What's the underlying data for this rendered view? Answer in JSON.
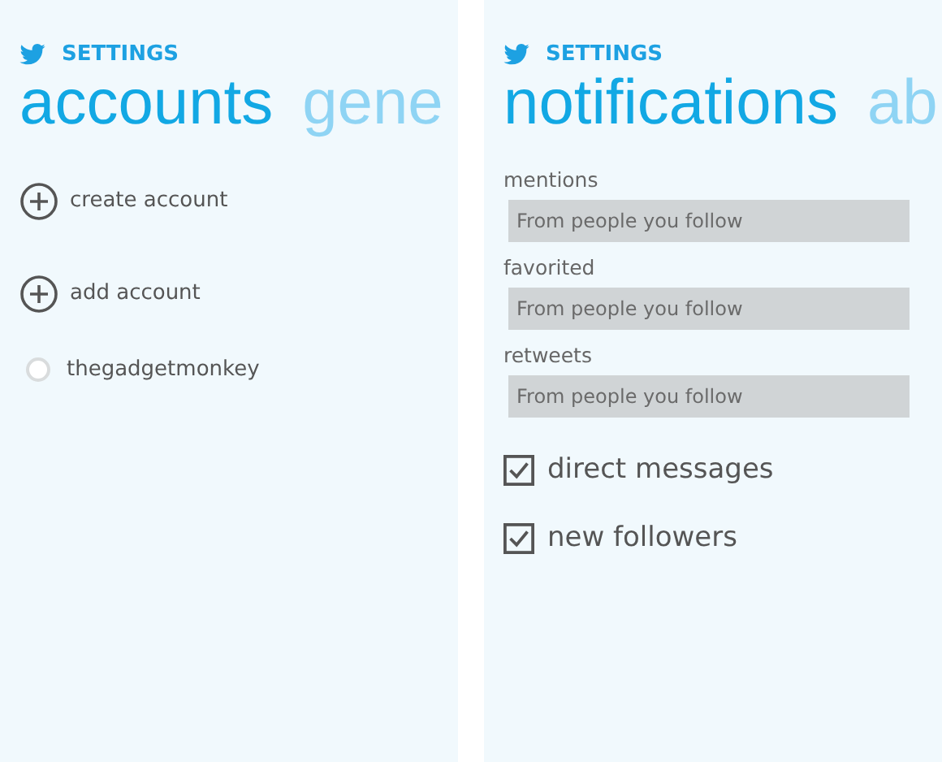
{
  "panels": [
    {
      "app_label": "SETTINGS",
      "pivots": [
        {
          "label": "accounts",
          "selected": true
        },
        {
          "label": "gene",
          "selected": false
        }
      ],
      "items": [
        {
          "kind": "add",
          "label": "create account"
        },
        {
          "kind": "add",
          "label": "add account"
        },
        {
          "kind": "account",
          "label": "thegadgetmonkey",
          "selected": false
        }
      ]
    },
    {
      "app_label": "SETTINGS",
      "pivots": [
        {
          "label": "notifications",
          "selected": true
        },
        {
          "label": "ab",
          "selected": false
        }
      ],
      "items": [
        {
          "kind": "dropdown",
          "label": "mentions",
          "value": "From people you follow"
        },
        {
          "kind": "dropdown",
          "label": "favorited",
          "value": "From people you follow"
        },
        {
          "kind": "dropdown",
          "label": "retweets",
          "value": "From people you follow"
        },
        {
          "kind": "checkbox",
          "label": "direct messages",
          "checked": true
        },
        {
          "kind": "checkbox",
          "label": "new followers",
          "checked": true
        }
      ]
    }
  ]
}
